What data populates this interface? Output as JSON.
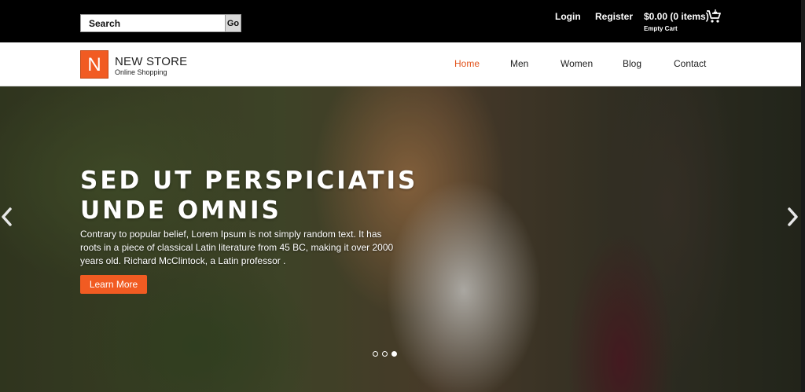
{
  "topbar": {
    "search_placeholder": "Search",
    "go_label": "Go",
    "login_label": "Login",
    "register_label": "Register",
    "cart_total": "$0.00 (0 items)",
    "cart_status": "Empty Cart"
  },
  "brand": {
    "logo_letter": "N",
    "name": "NEW STORE",
    "tagline": "Online Shopping",
    "accent_color": "#f15b22"
  },
  "nav": {
    "items": [
      {
        "label": "Home",
        "active": true
      },
      {
        "label": "Men",
        "active": false
      },
      {
        "label": "Women",
        "active": false
      },
      {
        "label": "Blog",
        "active": false
      },
      {
        "label": "Contact",
        "active": false
      }
    ]
  },
  "hero": {
    "title": "SED UT PERSPICIATIS UNDE OMNIS",
    "description": "Contrary to popular belief, Lorem Ipsum is not simply random text. It has roots in a piece of classical Latin literature from 45 BC, making it over 2000 years old. Richard McClintock, a Latin professor .",
    "button_label": "Learn More",
    "slides_count": 3,
    "active_slide": 3
  },
  "icons": {
    "cart": "cart-icon",
    "prev": "chevron-left-icon",
    "next": "chevron-right-icon"
  }
}
